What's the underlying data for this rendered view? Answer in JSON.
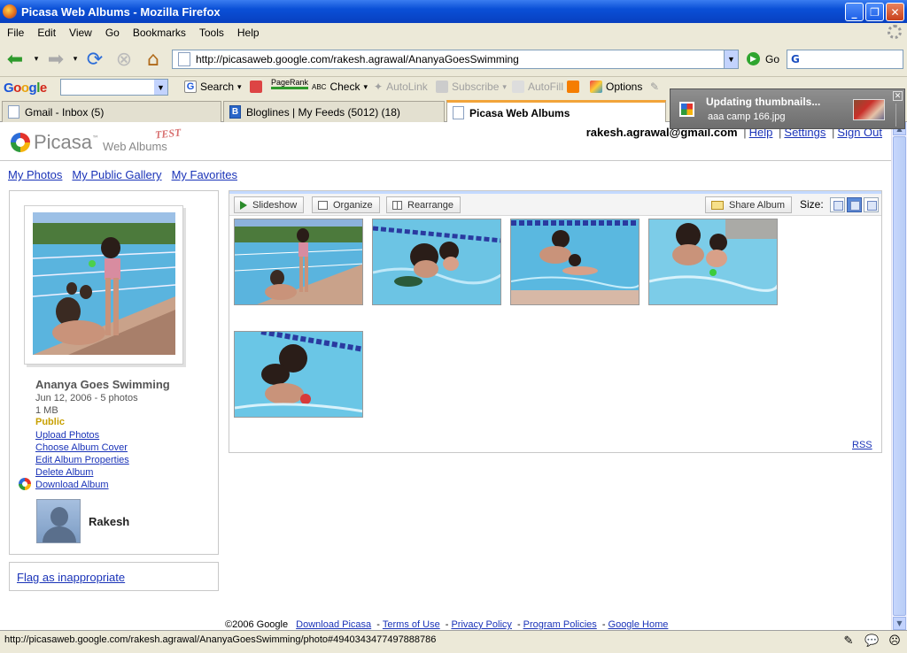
{
  "window": {
    "title": "Picasa Web Albums - Mozilla Firefox"
  },
  "menu": [
    "File",
    "Edit",
    "View",
    "Go",
    "Bookmarks",
    "Tools",
    "Help"
  ],
  "nav": {
    "url": "http://picasaweb.google.com/rakesh.agrawal/AnanyaGoesSwimming",
    "go_label": "Go"
  },
  "google_toolbar": {
    "logo": {
      "G": "G",
      "o1": "o",
      "o2": "o",
      "g": "g",
      "l": "l",
      "e": "e"
    },
    "search_label": "Search",
    "pagerank_label": "PageRank",
    "check_label": "Check",
    "autolink_label": "AutoLink",
    "subscribe_label": "Subscribe",
    "autofill_label": "AutoFill",
    "options_label": "Options"
  },
  "tabs": [
    {
      "label": "Gmail - Inbox (5)"
    },
    {
      "label": "Bloglines | My Feeds (5012) (18)"
    },
    {
      "label": "Picasa Web Albums"
    }
  ],
  "header": {
    "brand": "Picasa",
    "brand_tm": "™",
    "brand_sub": "Web Albums",
    "test_badge": "TEST",
    "email": "rakesh.agrawal@gmail.com",
    "help": "Help",
    "settings": "Settings",
    "signout": "Sign Out"
  },
  "topnav": [
    "My Photos",
    "My Public Gallery",
    "My Favorites"
  ],
  "album": {
    "title": "Ananya Goes Swimming",
    "date_count": "Jun 12, 2006 - 5 photos",
    "size": "1 MB",
    "visibility": "Public",
    "links": [
      "Upload Photos",
      "Choose Album Cover",
      "Edit Album Properties",
      "Delete Album",
      "Download Album"
    ],
    "owner": "Rakesh"
  },
  "flag_label": "Flag as inappropriate",
  "toolbar": {
    "slideshow": "Slideshow",
    "organize": "Organize",
    "rearrange": "Rearrange",
    "share": "Share Album",
    "size_label": "Size:"
  },
  "rss": "RSS",
  "footer": {
    "copyright": "©2006 Google",
    "links": [
      "Download Picasa",
      "Terms of Use",
      "Privacy Policy",
      "Program Policies",
      "Google Home"
    ]
  },
  "notification": {
    "title": "Updating thumbnails...",
    "subtitle": "aaa camp 166.jpg"
  },
  "status": {
    "text": "http://picasaweb.google.com/rakesh.agrawal/AnanyaGoesSwimming/photo#4940343477497888786"
  }
}
